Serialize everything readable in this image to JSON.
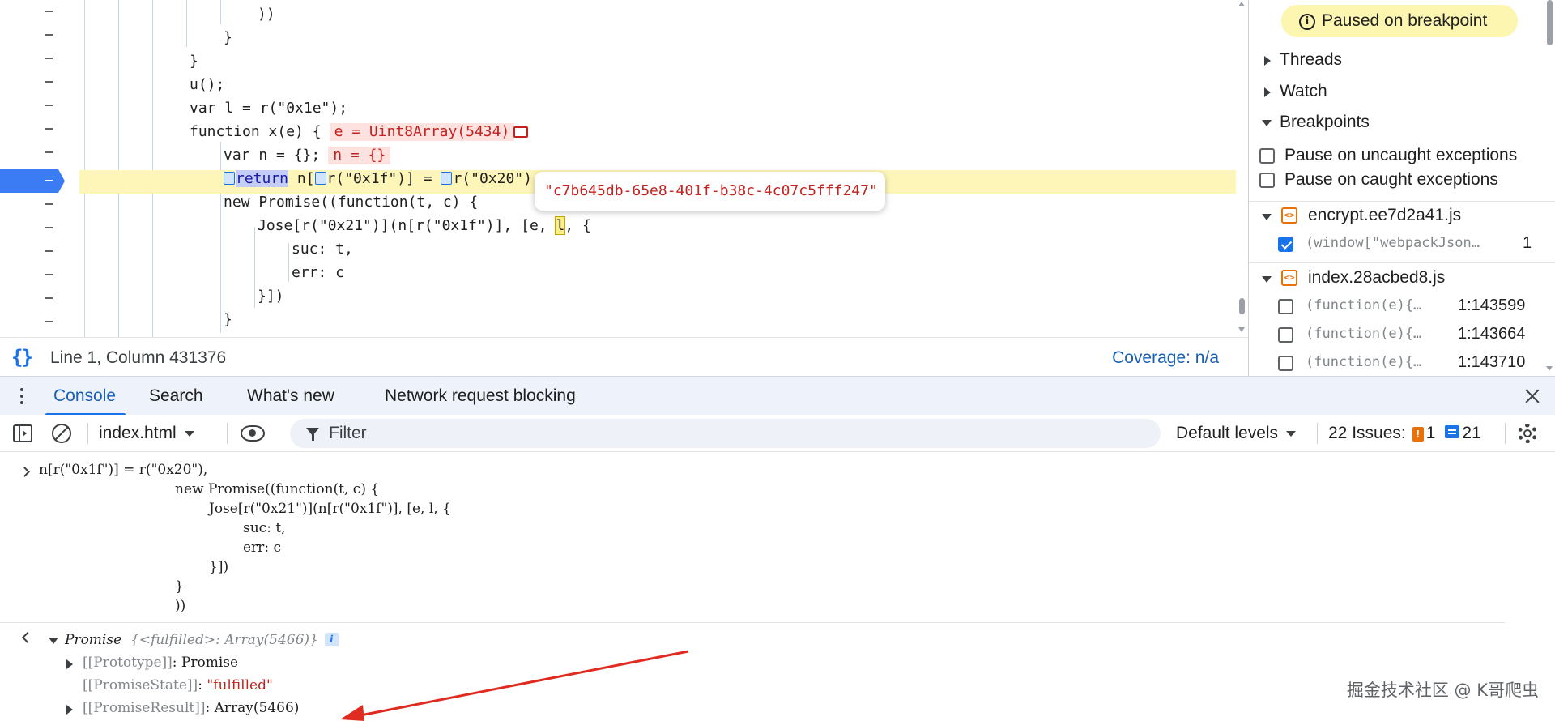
{
  "editor": {
    "lines": [
      {
        "text": "))"
      },
      {
        "text": "}"
      },
      {
        "text": "}"
      },
      {
        "text": "u();"
      },
      {
        "text": "var l = r(\"0x1e\");"
      },
      {
        "pre": "function x(e) {",
        "inline": "e = Uint8Array(5434)"
      },
      {
        "pre": "var n = {};",
        "inline": "n = {}"
      },
      {
        "pre_kw": "return",
        "code_a": " n[",
        "code_b": "r(\"0x1f\")] = ",
        "code_c": "r(\"0x20\"),"
      },
      {
        "text": "new Promise((function(t, c) {"
      },
      {
        "pre": "Jose[r(\"0x21\")](n[r(\"0x1f\")], [e, ",
        "hl": "l",
        "post": ", {"
      },
      {
        "text": "suc: t,"
      },
      {
        "text": "err: c"
      },
      {
        "text": "}])"
      },
      {
        "text": "}"
      }
    ],
    "tooltip": "\"c7b645db-65e8-401f-b38c-4c07c5fff247\""
  },
  "statusbar": {
    "position": "Line 1, Column 431376",
    "coverage": "Coverage: n/a"
  },
  "sidebar": {
    "paused": "Paused on breakpoint",
    "threads": "Threads",
    "watch": "Watch",
    "breakpoints": "Breakpoints",
    "pause_uncaught": "Pause on uncaught exceptions",
    "pause_caught": "Pause on caught exceptions",
    "files": [
      {
        "name": "encrypt.ee7d2a41.js",
        "items": [
          {
            "code": "(window[\"webpackJson…",
            "line": "1",
            "checked": true
          }
        ]
      },
      {
        "name": "index.28acbed8.js",
        "items": [
          {
            "code": "(function(e){…",
            "line": "1:143599",
            "checked": false
          },
          {
            "code": "(function(e){…",
            "line": "1:143664",
            "checked": false
          },
          {
            "code": "(function(e){…",
            "line": "1:143710",
            "checked": false
          }
        ]
      }
    ]
  },
  "drawer": {
    "tabs": [
      "Console",
      "Search",
      "What's new",
      "Network request blocking"
    ]
  },
  "toolbar": {
    "context": "index.html",
    "filter_placeholder": "Filter",
    "levels": "Default levels",
    "issues_label": "22 Issues:",
    "issues_warn": "1",
    "issues_info": "21"
  },
  "console": {
    "input_lines": [
      "n[r(\"0x1f\")] = r(\"0x20\"),",
      "new Promise((function(t, c) {",
      "Jose[r(\"0x21\")](n[r(\"0x1f\")], [e, l, {",
      "suc: t,",
      "err: c",
      "}])",
      "}",
      "))"
    ],
    "result": {
      "head": "Promise",
      "summary": "{<fulfilled>: Array(5466)}",
      "info": "i",
      "prototype_key": "[[Prototype]]",
      "prototype_val": "Promise",
      "state_key": "[[PromiseState]]",
      "state_val": "\"fulfilled\"",
      "result_key": "[[PromiseResult]]",
      "result_val": "Array(5466)"
    }
  },
  "watermark": "掘金技术社区 @ K哥爬虫",
  "colors": {
    "accent": "#1a73e8",
    "exec_line": "#fef6b8",
    "paused_badge": "#fcf6b1",
    "annotation_arrow": "#e02b20"
  }
}
